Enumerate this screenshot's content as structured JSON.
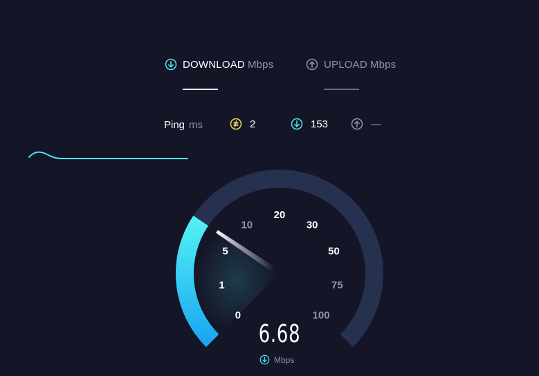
{
  "header": {
    "download": {
      "label": "DOWNLOAD",
      "unit": "Mbps",
      "icon": "download-arrow-icon"
    },
    "upload": {
      "label": "UPLOAD",
      "unit": "Mbps",
      "icon": "upload-arrow-icon"
    }
  },
  "ping": {
    "label": "Ping",
    "unit": "ms",
    "idle": {
      "icon": "idle-latency-icon",
      "value": "2"
    },
    "download": {
      "icon": "download-latency-icon",
      "value": "153"
    },
    "upload": {
      "icon": "upload-latency-icon",
      "value": "—"
    }
  },
  "gauge": {
    "ticks": [
      "0",
      "1",
      "5",
      "10",
      "20",
      "30",
      "50",
      "75",
      "100"
    ],
    "needle_value_mbps": 6.68,
    "max_mbps": 100
  },
  "result": {
    "value": "6.68",
    "unit": "Mbps",
    "icon": "download-arrow-icon"
  },
  "colors": {
    "background": "#141526",
    "accent": "#4de6f2",
    "track": "#26304f",
    "idle": "#f2d95c",
    "muted": "#9193a8"
  }
}
